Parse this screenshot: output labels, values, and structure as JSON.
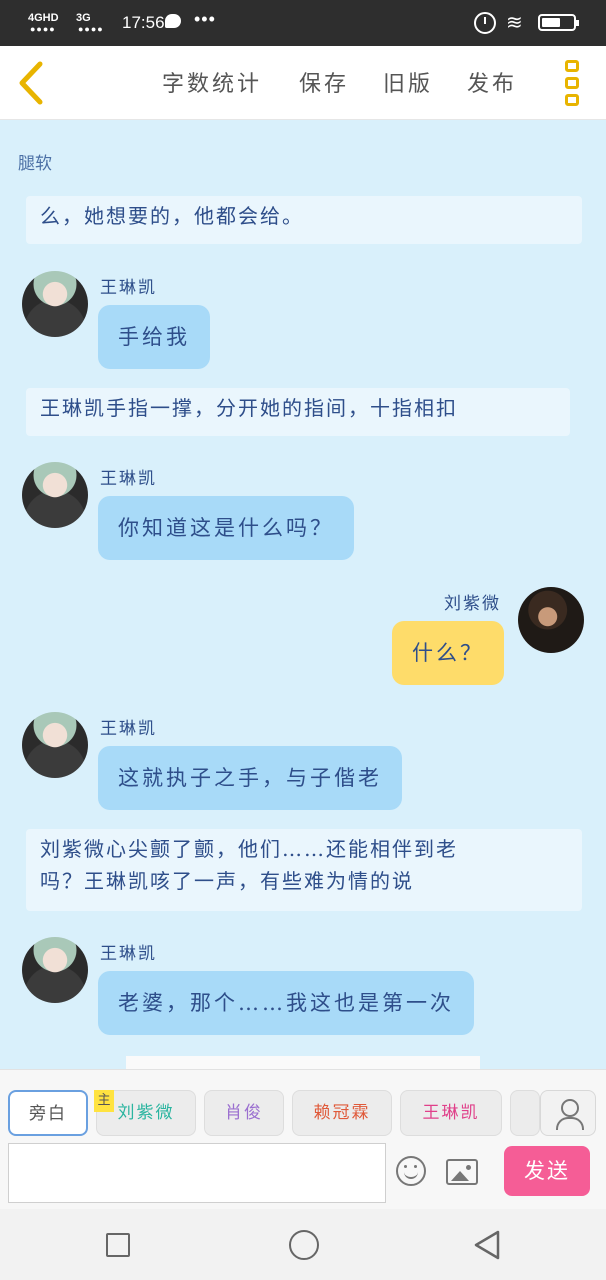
{
  "status_bar": {
    "network_1": "4GHD",
    "network_2": "3G",
    "time": "17:56",
    "more": "•••"
  },
  "toolbar": {
    "back_icon": "chevron-left-icon",
    "word_count": "字数统计",
    "save": "保存",
    "old_version": "旧版",
    "publish": "发布",
    "menu_icon": "vertical-dots-icon"
  },
  "chat": {
    "title": "腿软",
    "messages": [
      {
        "type": "narration",
        "text": "么，她想要的，他都会给。"
      },
      {
        "type": "dialogue",
        "speaker": "王琳凯",
        "text": "手给我"
      },
      {
        "type": "narration",
        "text": "王琳凯手指一撑，分开她的指间，十指相扣"
      },
      {
        "type": "dialogue",
        "speaker": "王琳凯",
        "text": "你知道这是什么吗？"
      },
      {
        "type": "dialogue",
        "speaker": "刘紫微",
        "text": "什么？"
      },
      {
        "type": "dialogue",
        "speaker": "王琳凯",
        "text": "这就执子之手，与子偕老"
      },
      {
        "type": "narration",
        "line1": "刘紫微心尖颤了颤，他们……还能相伴到老",
        "line2": "吗？王琳凯咳了一声，有些难为情的说"
      },
      {
        "type": "dialogue",
        "speaker": "王琳凯",
        "text": "老婆，那个……我这也是第一次"
      }
    ]
  },
  "roles": {
    "tabs": [
      {
        "label": "旁白",
        "color": "#555555"
      },
      {
        "label": "刘紫微",
        "color": "#2bb5a0",
        "badge": "主"
      },
      {
        "label": "肖俊",
        "color": "#9b6fd0"
      },
      {
        "label": "赖冠霖",
        "color": "#e05a3a"
      },
      {
        "label": "王琳凯",
        "color": "#e0408a"
      }
    ],
    "contact_icon": "person-icon"
  },
  "input": {
    "placeholder": "",
    "emoji_icon": "emoji-icon",
    "image_icon": "image-icon",
    "send": "发送"
  },
  "nav": {
    "recent_icon": "square-icon",
    "home_icon": "circle-icon",
    "back_icon": "triangle-back-icon"
  }
}
